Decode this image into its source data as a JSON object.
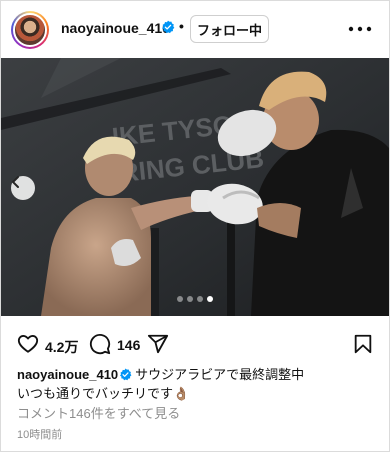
{
  "header": {
    "username": "naoyainoue_410",
    "separator": "•",
    "follow_label": "フォロー中"
  },
  "photo": {
    "wall_text_line1": "IKE TYSON",
    "wall_text_line2": "RING CLUB",
    "carousel_total": 4,
    "carousel_active_index": 3
  },
  "actions": {
    "like_count": "4.2万",
    "comment_count": "146"
  },
  "caption": {
    "username": "naoyainoue_410",
    "line1": "サウジアラビアで最終調整中",
    "line2": "いつも通りでバッチリです👌🏽"
  },
  "view_comments": "コメント146件をすべて見る",
  "timestamp": "10時間前",
  "colors": {
    "verified": "#0095f6",
    "muted": "#8e8e8e",
    "text": "#111111"
  }
}
